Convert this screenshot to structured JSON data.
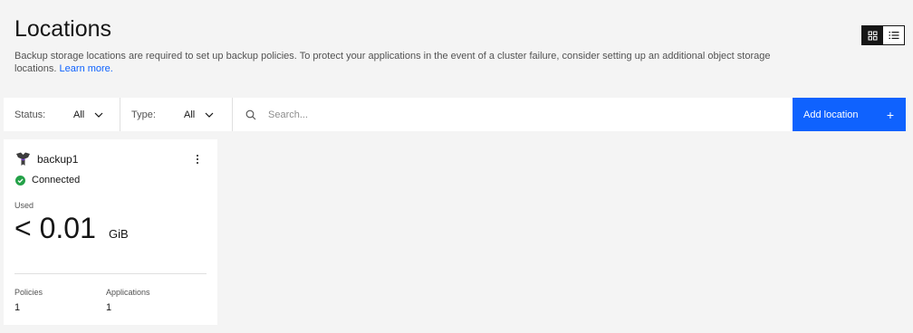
{
  "header": {
    "title": "Locations",
    "description": "Backup storage locations are required to set up backup policies. To protect your applications in the event of a cluster failure, consider setting up an additional object storage locations.",
    "learn_more": "Learn more."
  },
  "view_toggle": {
    "active": "grid",
    "options": [
      "grid",
      "list"
    ]
  },
  "toolbar": {
    "status_label": "Status:",
    "status_value": "All",
    "type_label": "Type:",
    "type_value": "All",
    "search_placeholder": "Search...",
    "add_label": "Add location",
    "add_icon": "+"
  },
  "cards": [
    {
      "name": "backup1",
      "icon": "storage-location-icon",
      "status": "Connected",
      "status_color": "#24a148",
      "used_label": "Used",
      "used_value": "< 0.01",
      "used_unit": "GiB",
      "policies_label": "Policies",
      "policies_value": "1",
      "applications_label": "Applications",
      "applications_value": "1"
    }
  ],
  "colors": {
    "accent": "#0f62fe",
    "background": "#f4f4f4",
    "surface": "#ffffff",
    "text": "#161616"
  }
}
